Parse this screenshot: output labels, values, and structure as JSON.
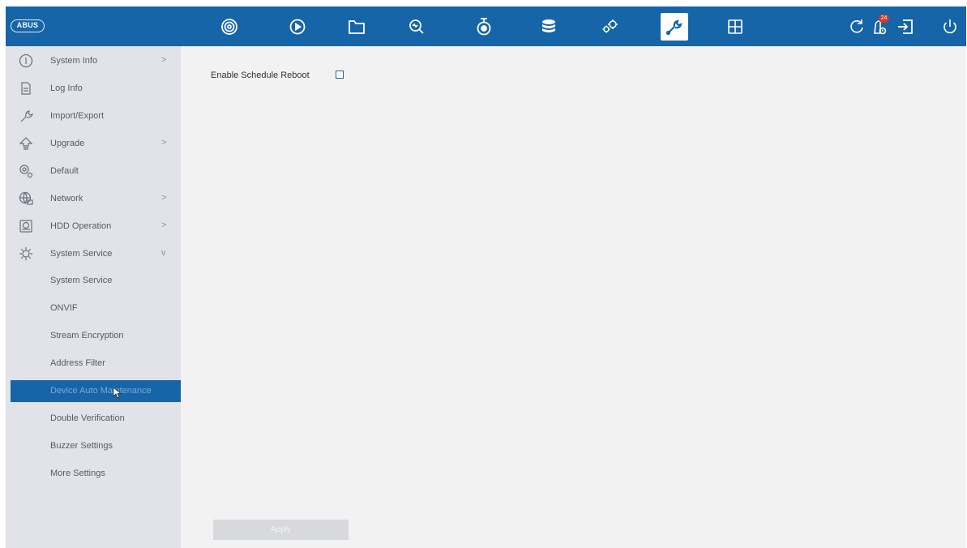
{
  "brand": {
    "logo_text": "ABUS"
  },
  "topbar": {
    "nav_icons": [
      {
        "name": "live-view-icon",
        "active": false
      },
      {
        "name": "playback-icon",
        "active": false
      },
      {
        "name": "file-management-icon",
        "active": false
      },
      {
        "name": "smart-search-icon",
        "active": false
      },
      {
        "name": "camera-icon",
        "active": false
      },
      {
        "name": "storage-icon",
        "active": false
      },
      {
        "name": "configuration-icon",
        "active": false
      },
      {
        "name": "maintenance-icon",
        "active": true
      },
      {
        "name": "multi-screen-icon",
        "active": false
      }
    ],
    "right_icons": [
      "refresh-icon",
      "alarm-icon",
      "logout-icon",
      "power-icon"
    ],
    "alarm_badge": "24"
  },
  "sidebar": {
    "items": [
      {
        "label": "System Info",
        "icon": "info-icon",
        "chevron": ">"
      },
      {
        "label": "Log Info",
        "icon": "log-icon",
        "chevron": ""
      },
      {
        "label": "Import/Export",
        "icon": "import-export-icon",
        "chevron": ""
      },
      {
        "label": "Upgrade",
        "icon": "upgrade-icon",
        "chevron": ">"
      },
      {
        "label": "Default",
        "icon": "default-icon",
        "chevron": ""
      },
      {
        "label": "Network",
        "icon": "network-icon",
        "chevron": ">"
      },
      {
        "label": "HDD Operation",
        "icon": "hdd-icon",
        "chevron": ">"
      },
      {
        "label": "System Service",
        "icon": "system-service-icon",
        "chevron": "v"
      }
    ],
    "sub_items": [
      {
        "label": "System Service",
        "selected": false
      },
      {
        "label": "ONVIF",
        "selected": false
      },
      {
        "label": "Stream Encryption",
        "selected": false
      },
      {
        "label": "Address Filter",
        "selected": false
      },
      {
        "label": "Device Auto Maintenance",
        "selected": true
      },
      {
        "label": "Double Verification",
        "selected": false
      },
      {
        "label": "Buzzer Settings",
        "selected": false
      },
      {
        "label": "More Settings",
        "selected": false
      }
    ]
  },
  "main": {
    "enable_schedule_reboot_label": "Enable Schedule Reboot",
    "enable_schedule_reboot_checked": false,
    "apply_label": "Apply"
  },
  "colors": {
    "accent": "#1565a8",
    "sidebar_bg": "#e1e3e8",
    "content_bg": "#f2f2f2",
    "badge": "#d9342b"
  }
}
